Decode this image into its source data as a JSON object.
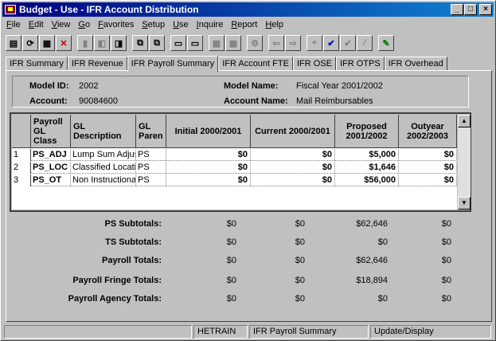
{
  "window": {
    "title": "Budget - Use - IFR Account Distribution",
    "controls": [
      "_",
      "□",
      "×"
    ]
  },
  "menu": [
    "File",
    "Edit",
    "View",
    "Go",
    "Favorites",
    "Setup",
    "Use",
    "Inquire",
    "Report",
    "Help"
  ],
  "toolbar": [
    {
      "icon": "save-icon",
      "glyph": "▤",
      "enabled": true
    },
    {
      "icon": "refresh-icon",
      "glyph": "⟳",
      "enabled": true
    },
    {
      "icon": "filter-icon",
      "glyph": "▦",
      "enabled": true
    },
    {
      "icon": "delete-icon",
      "glyph": "✕",
      "enabled": true,
      "color": "#c00000"
    },
    {
      "icon": "first-record-icon",
      "glyph": "▮",
      "enabled": false
    },
    {
      "icon": "prev-record-icon",
      "glyph": "◧",
      "enabled": false
    },
    {
      "icon": "next-record-icon",
      "glyph": "◨",
      "enabled": true
    },
    {
      "icon": "copy-icon",
      "glyph": "⧉",
      "enabled": true
    },
    {
      "icon": "paste-icon",
      "glyph": "⧉",
      "enabled": true
    },
    {
      "icon": "window-icon",
      "glyph": "▭",
      "enabled": true
    },
    {
      "icon": "window-select-icon",
      "glyph": "▭",
      "enabled": true
    },
    {
      "icon": "grid-icon",
      "glyph": "▦",
      "enabled": false
    },
    {
      "icon": "grid2-icon",
      "glyph": "▦",
      "enabled": false
    },
    {
      "icon": "gear-icon",
      "glyph": "⚙",
      "enabled": false
    },
    {
      "icon": "back-icon",
      "glyph": "⇦",
      "enabled": false
    },
    {
      "icon": "forward-icon",
      "glyph": "⇨",
      "enabled": false
    },
    {
      "icon": "add-icon",
      "glyph": "+",
      "enabled": false
    },
    {
      "icon": "check-icon",
      "glyph": "✔",
      "enabled": true,
      "color": "#0000c0"
    },
    {
      "icon": "check-edit-icon",
      "glyph": "✔",
      "enabled": false
    },
    {
      "icon": "edit-icon",
      "glyph": "∕",
      "enabled": false
    },
    {
      "icon": "pencil-icon",
      "glyph": "✎",
      "enabled": true,
      "color": "#008000"
    }
  ],
  "tabs": [
    "IFR Summary",
    "IFR Revenue",
    "IFR Payroll Summary",
    "IFR Account FTE",
    "IFR OSE",
    "IFR OTPS",
    "IFR Overhead"
  ],
  "active_tab": "IFR Payroll Summary",
  "info": {
    "model_id_label": "Model ID:",
    "model_id": "2002",
    "account_label": "Account:",
    "account": "90084600",
    "model_name_label": "Model Name:",
    "model_name": "Fiscal Year 2001/2002",
    "account_name_label": "Account Name:",
    "account_name": "Mail Reimbursables"
  },
  "grid": {
    "headers": [
      "Payroll GL Class",
      "GL Description",
      "GL Paren",
      "Initial 2000/2001",
      "Current 2000/2001",
      "Proposed 2001/2002",
      "Outyear 2002/2003"
    ],
    "rows": [
      [
        "1",
        "PS_ADJ",
        "Lump Sum Adjust",
        "PS",
        "$0",
        "$0",
        "$5,000",
        "$0"
      ],
      [
        "2",
        "PS_LOC",
        "Classified Locatio",
        "PS",
        "$0",
        "$0",
        "$1,646",
        "$0"
      ],
      [
        "3",
        "PS_OT",
        "Non Instructional",
        "PS",
        "$0",
        "$0",
        "$56,000",
        "$0"
      ]
    ]
  },
  "totals": [
    {
      "label": "PS Subtotals:",
      "values": [
        "$0",
        "$0",
        "$62,646",
        "$0"
      ]
    },
    {
      "label": "TS Subtotals:",
      "values": [
        "$0",
        "$0",
        "$0",
        "$0"
      ]
    },
    {
      "label": "Payroll Totals:",
      "values": [
        "$0",
        "$0",
        "$62,646",
        "$0"
      ]
    },
    {
      "label": "Payroll Fringe Totals:",
      "values": [
        "$0",
        "$0",
        "$18,894",
        "$0"
      ]
    },
    {
      "label": "Payroll Agency Totals:",
      "values": [
        "$0",
        "$0",
        "$0",
        "$0"
      ]
    }
  ],
  "status": [
    "",
    "HETRAIN",
    "IFR Payroll Summary",
    "Update/Display"
  ]
}
